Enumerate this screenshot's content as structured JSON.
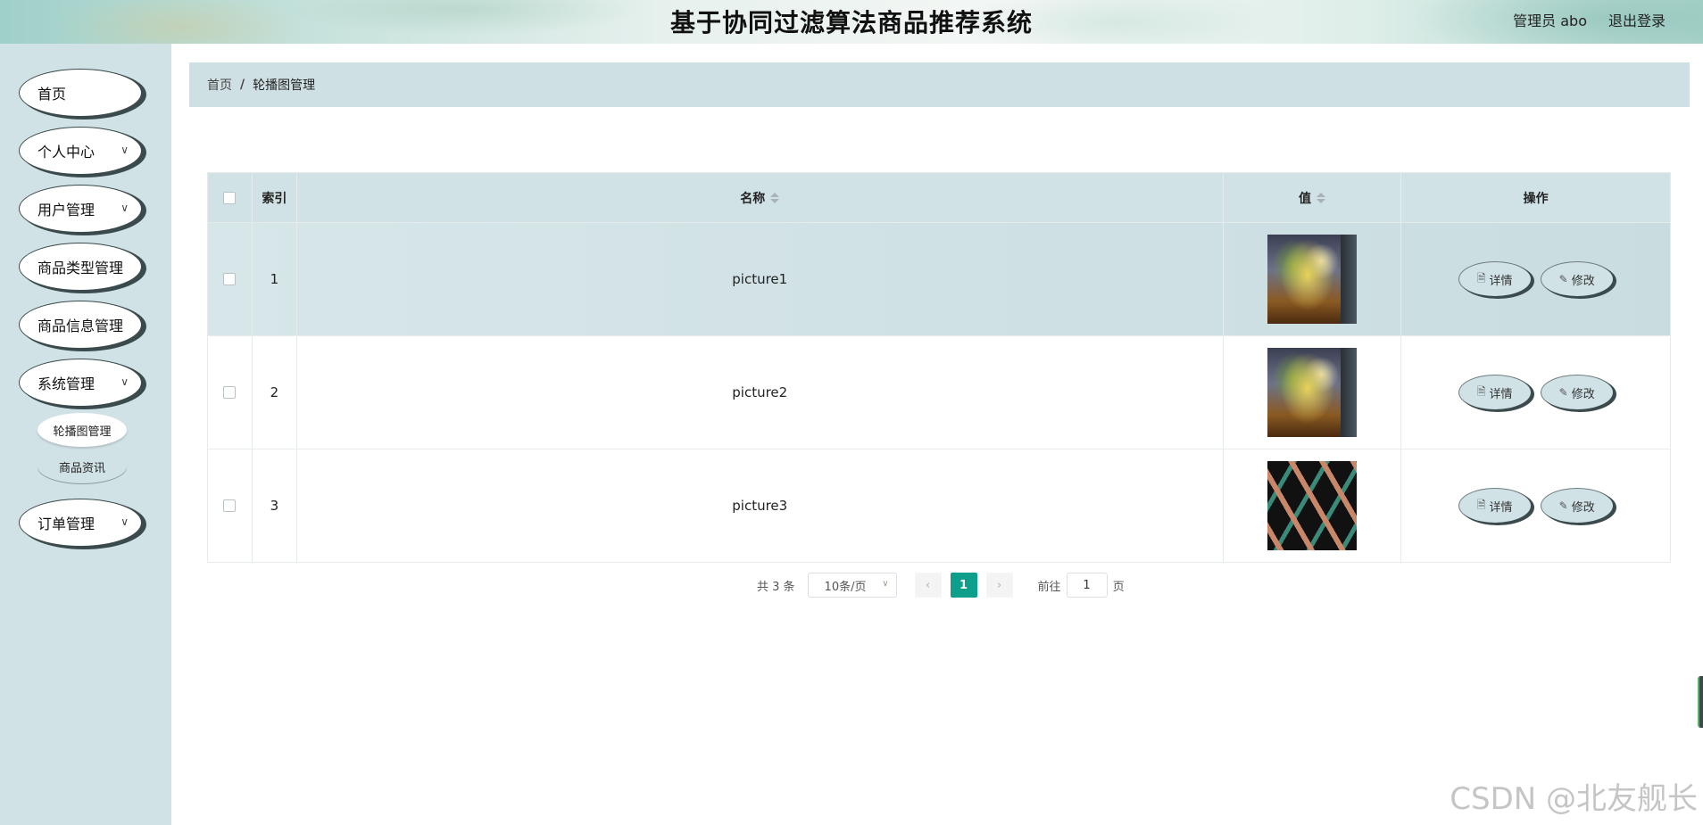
{
  "header": {
    "title": "基于协同过滤算法商品推荐系统",
    "user": "管理员 abo",
    "logout": "退出登录"
  },
  "sidebar": {
    "items": [
      {
        "label": "首页"
      },
      {
        "label": "个人中心"
      },
      {
        "label": "用户管理"
      },
      {
        "label": "商品类型管理"
      },
      {
        "label": "商品信息管理"
      },
      {
        "label": "系统管理"
      },
      {
        "label": "订单管理"
      }
    ],
    "sub_items": [
      {
        "label": "轮播图管理",
        "active": true
      },
      {
        "label": "商品资讯",
        "active": false
      }
    ]
  },
  "breadcrumb": {
    "home": "首页",
    "separator": "/",
    "current": "轮播图管理"
  },
  "table": {
    "columns": [
      "索引",
      "名称",
      "值",
      "操作"
    ],
    "rows": [
      {
        "index": "1",
        "name": "picture1",
        "image": "food-image"
      },
      {
        "index": "2",
        "name": "picture2",
        "image": "food-image"
      },
      {
        "index": "3",
        "name": "picture3",
        "image": "pattern-image"
      }
    ],
    "actions": {
      "detail": "详情",
      "edit": "修改"
    }
  },
  "pagination": {
    "total": "共 3 条",
    "page_size": "10条/页",
    "current_page": "1",
    "goto_prefix": "前往",
    "goto_value": "1",
    "goto_suffix": "页"
  },
  "watermark": "CSDN @北友舰长",
  "colors": {
    "sidebar_bg": "#d1e2e6",
    "accent": "#0e9e8c"
  }
}
